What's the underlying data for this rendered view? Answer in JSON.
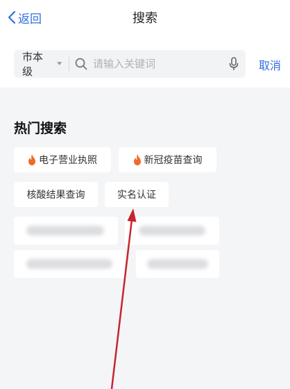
{
  "nav": {
    "back_label": "返回",
    "title": "搜索"
  },
  "search": {
    "level": "市本级",
    "placeholder": "请输入关键词",
    "cancel_label": "取消"
  },
  "hot": {
    "title": "热门搜索",
    "tags": [
      {
        "label": "电子营业执照",
        "hot": true
      },
      {
        "label": "新冠疫苗查询",
        "hot": true
      },
      {
        "label": "核酸结果查询",
        "hot": false
      },
      {
        "label": "实名认证",
        "hot": false
      }
    ]
  },
  "colors": {
    "accent": "#2f6fe0",
    "fire": "#f06a2a",
    "annotation": "#c8232c"
  }
}
